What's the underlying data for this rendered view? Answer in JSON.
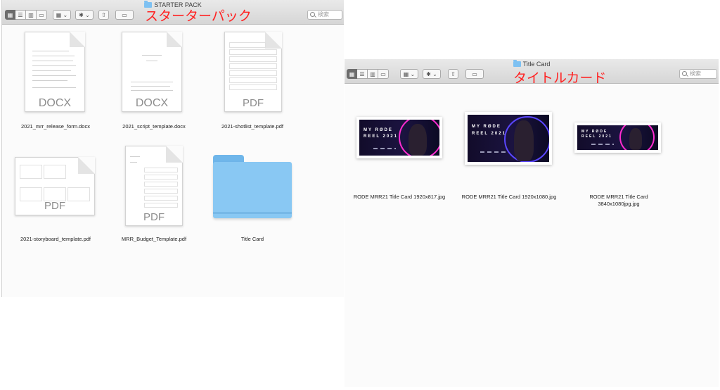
{
  "left_window": {
    "title": "STARTER PACK",
    "annotation": "スターターパック",
    "search_placeholder": "検索",
    "items": [
      {
        "name": "2021_mrr_release_form.docx",
        "type": "DOCX"
      },
      {
        "name": "2021_script_template.docx",
        "type": "DOCX"
      },
      {
        "name": "2021-shotlist_template.pdf",
        "type": "PDF"
      },
      {
        "name": "2021-storyboard_template.pdf",
        "type": "PDF"
      },
      {
        "name": "MRR_Budget_Template.pdf",
        "type": "PDF"
      },
      {
        "name": "Title Card",
        "type": "folder"
      }
    ]
  },
  "right_window": {
    "title": "Title Card",
    "annotation": "タイトルカード",
    "search_placeholder": "検索",
    "items": [
      {
        "name_line1": "RODE MRR21 Title Card 1920x817.jpg",
        "name_line2": ""
      },
      {
        "name_line1": "RODE MRR21 Title Card 1920x1080.jpg",
        "name_line2": ""
      },
      {
        "name_line1": "RODE MRR21 Title Card",
        "name_line2": "3840x1080jpg.jpg"
      }
    ]
  },
  "thumb_logo": {
    "line1": "MY RØDE",
    "line2": "REEL 2021"
  },
  "colors": {
    "folder": "#89c8f3",
    "annotation": "#ff2222",
    "toolbar": "#dcdcdc"
  },
  "icons": {
    "view": [
      "icon-view-icon",
      "list-view-icon",
      "column-view-icon",
      "gallery-view-icon"
    ],
    "group": "group-icon",
    "action": "gear-icon",
    "share": "share-icon",
    "tag": "tag-icon",
    "search": "search-icon"
  }
}
